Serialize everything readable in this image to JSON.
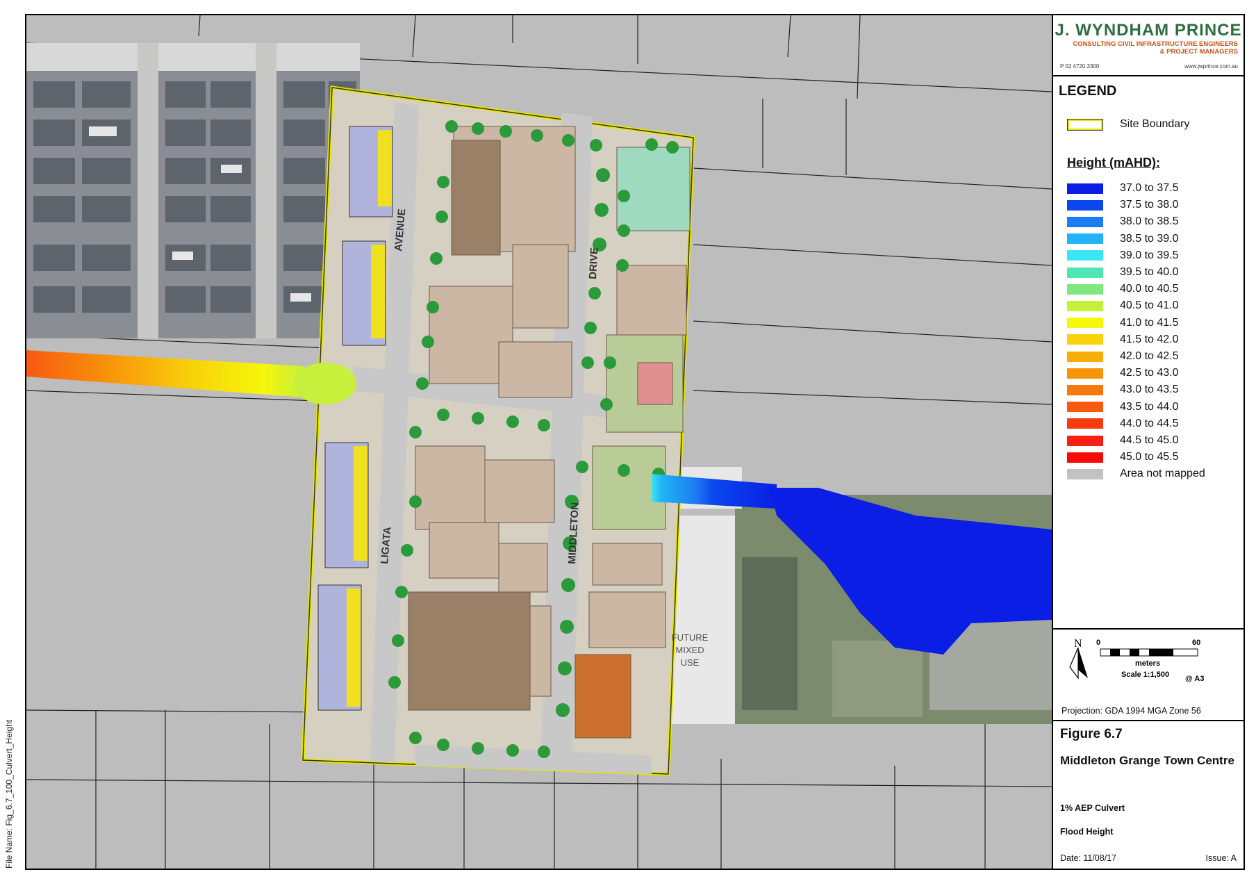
{
  "company": {
    "name": "J. WYNDHAM PRINCE",
    "tagline_1": "CONSULTING CIVIL INFRASTRUCTURE ENGINEERS",
    "tagline_2": "& PROJECT MANAGERS",
    "phone": "P 02 4720 3300",
    "web": "www.jwprince.com.au"
  },
  "legend": {
    "title": "LEGEND",
    "site_boundary": "Site Boundary",
    "height_heading": "Height (mAHD):",
    "items": [
      {
        "label": "37.0 to 37.5",
        "color": "#0a1ee6"
      },
      {
        "label": "37.5 to 38.0",
        "color": "#0b46ee"
      },
      {
        "label": "38.0 to 38.5",
        "color": "#1c7cf2"
      },
      {
        "label": "38.5 to 39.0",
        "color": "#22b4f6"
      },
      {
        "label": "39.0 to 39.5",
        "color": "#3ae6f4"
      },
      {
        "label": "39.5 to 40.0",
        "color": "#4ee6b4"
      },
      {
        "label": "40.0 to 40.5",
        "color": "#80e880"
      },
      {
        "label": "40.5 to 41.0",
        "color": "#c6f03c"
      },
      {
        "label": "41.0 to 41.5",
        "color": "#f6f60a"
      },
      {
        "label": "41.5 to 42.0",
        "color": "#f8d20a"
      },
      {
        "label": "42.0 to 42.5",
        "color": "#f8ae0a"
      },
      {
        "label": "42.5 to 43.0",
        "color": "#f8940a"
      },
      {
        "label": "43.0 to 43.5",
        "color": "#f8780e"
      },
      {
        "label": "43.5 to 44.0",
        "color": "#f85a10"
      },
      {
        "label": "44.0 to 44.5",
        "color": "#f83c10"
      },
      {
        "label": "44.5 to 45.0",
        "color": "#f82010"
      },
      {
        "label": "45.0 to 45.5",
        "color": "#f80a0a"
      },
      {
        "label": "Area not mapped",
        "color": "#c2c2c2"
      }
    ]
  },
  "scale": {
    "north": "N",
    "start": "0",
    "end": "60",
    "units": "meters",
    "ratio": "Scale 1:1,500",
    "paper": "@ A3",
    "projection": "Projection: GDA 1994 MGA Zone 56"
  },
  "title_block": {
    "figure": "Figure 6.7",
    "name": "Middleton Grange Town Centre",
    "subtitle_1": "1% AEP Culvert",
    "subtitle_2": "Flood Height",
    "date": "Date: 11/08/17",
    "issue": "Issue: A"
  },
  "file_name": "File Name: Fig_6.7_100_Culvert_Height",
  "map_labels": {
    "avenue": "AVENUE",
    "ligata": "LIGATA",
    "middleton": "MIDDLETON",
    "drive": "DRIVE",
    "future_1": "FUTURE",
    "future_2": "MIXED",
    "future_3": "USE"
  }
}
